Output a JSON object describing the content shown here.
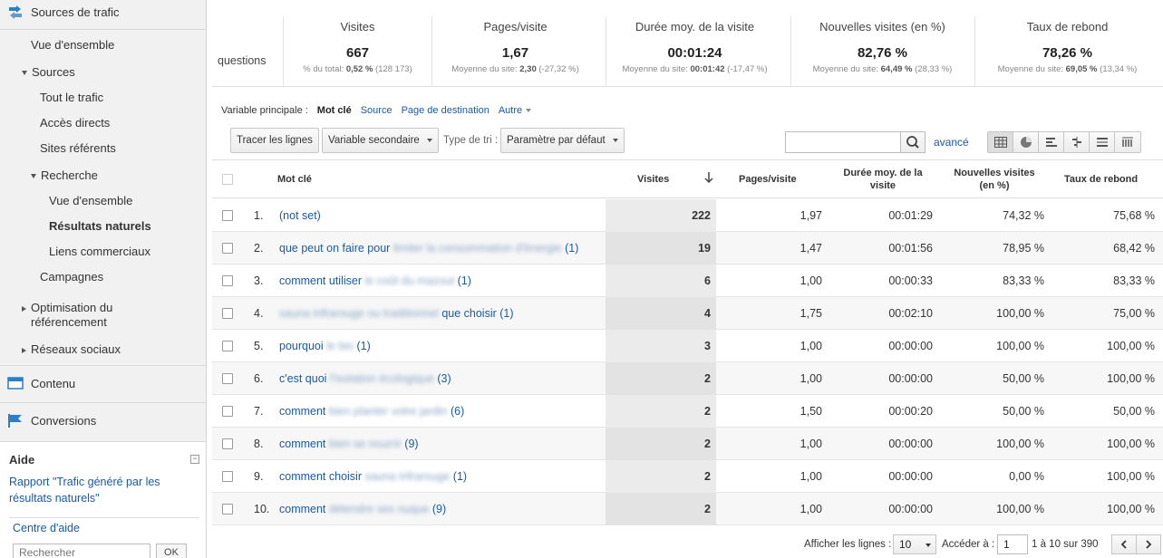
{
  "sidebar": {
    "traffic_sources": "Sources de trafic",
    "overview": "Vue d'ensemble",
    "sources": "Sources",
    "all_traffic": "Tout le trafic",
    "direct": "Accès directs",
    "referrals": "Sites référents",
    "search": "Recherche",
    "search_overview": "Vue d'ensemble",
    "organic": "Résultats naturels",
    "paid": "Liens commerciaux",
    "campaigns": "Campagnes",
    "seo_line1": "Optimisation du",
    "seo_line2": "référencement",
    "social": "Réseaux sociaux",
    "content": "Contenu",
    "conversions": "Conversions"
  },
  "help": {
    "title": "Aide",
    "report_link_line1": "Rapport \"Trafic généré par les",
    "report_link_line2": "résultats naturels\"",
    "help_center": "Centre d'aide",
    "search_placeholder": "Rechercher",
    "ok": "OK"
  },
  "scorecard": {
    "label": "questions",
    "metrics": [
      {
        "name": "Visites",
        "value": "667",
        "sub_prefix": "% du total: ",
        "sub_bold": "0,52 %",
        "sub_suffix": " (128 173)"
      },
      {
        "name": "Pages/visite",
        "value": "1,67",
        "sub_prefix": "Moyenne du site: ",
        "sub_bold": "2,30",
        "sub_suffix": " (-27,32 %)"
      },
      {
        "name": "Durée moy. de la visite",
        "value": "00:01:24",
        "sub_prefix": "Moyenne du site: ",
        "sub_bold": "00:01:42",
        "sub_suffix": " (-17,47 %)"
      },
      {
        "name": "Nouvelles visites (en %)",
        "value": "82,76 %",
        "sub_prefix": "Moyenne du site: ",
        "sub_bold": "64,49 %",
        "sub_suffix": " (28,33 %)"
      },
      {
        "name": "Taux de rebond",
        "value": "78,26 %",
        "sub_prefix": "Moyenne du site: ",
        "sub_bold": "69,05 %",
        "sub_suffix": " (13,34 %)"
      }
    ]
  },
  "dimension_bar": {
    "label": "Variable principale :",
    "selected": "Mot clé",
    "source": "Source",
    "landing": "Page de destination",
    "other": "Autre"
  },
  "toolbar": {
    "plot_rows": "Tracer les lignes",
    "secondary": "Variable secondaire",
    "sort_type_label": "Type de tri :",
    "sort_default": "Paramètre par défaut",
    "advanced": "avancé"
  },
  "table": {
    "headers": {
      "keyword": "Mot clé",
      "visits": "Visites",
      "pages": "Pages/visite",
      "duration_line1": "Durée moy. de la",
      "duration_line2": "visite",
      "new_line1": "Nouvelles visites",
      "new_line2": "(en %)",
      "bounce": "Taux de rebond"
    },
    "rows": [
      {
        "n": "1.",
        "kw": "(not set)",
        "blur": "",
        "tail": "",
        "visits": "222",
        "pages": "1,97",
        "dur": "00:01:29",
        "newv": "74,32 %",
        "bounce": "75,68 %"
      },
      {
        "n": "2.",
        "kw": "que peut on faire pour",
        "blur": "limiter la consommation d'énergie",
        "tail": "(1)",
        "visits": "19",
        "pages": "1,47",
        "dur": "00:01:56",
        "newv": "78,95 %",
        "bounce": "68,42 %"
      },
      {
        "n": "3.",
        "kw": "comment utiliser",
        "blur": "le coût du mazout",
        "tail": "(1)",
        "visits": "6",
        "pages": "1,00",
        "dur": "00:00:33",
        "newv": "83,33 %",
        "bounce": "83,33 %"
      },
      {
        "n": "4.",
        "kw": "",
        "blur": "sauna infrarouge ou traditionnel",
        "tail": "que choisir (1)",
        "visits": "4",
        "pages": "1,75",
        "dur": "00:02:10",
        "newv": "100,00 %",
        "bounce": "75,00 %"
      },
      {
        "n": "5.",
        "kw": "pourquoi",
        "blur": "le bio",
        "tail": "(1)",
        "visits": "3",
        "pages": "1,00",
        "dur": "00:00:00",
        "newv": "100,00 %",
        "bounce": "100,00 %"
      },
      {
        "n": "6.",
        "kw": "c'est quoi",
        "blur": "l'isolation écologique",
        "tail": "(3)",
        "visits": "2",
        "pages": "1,00",
        "dur": "00:00:00",
        "newv": "50,00 %",
        "bounce": "100,00 %"
      },
      {
        "n": "7.",
        "kw": "comment",
        "blur": "bien planter votre jardin",
        "tail": "(6)",
        "visits": "2",
        "pages": "1,50",
        "dur": "00:00:20",
        "newv": "50,00 %",
        "bounce": "50,00 %"
      },
      {
        "n": "8.",
        "kw": "comment",
        "blur": "bien se nourrir",
        "tail": "(9)",
        "visits": "2",
        "pages": "1,00",
        "dur": "00:00:00",
        "newv": "100,00 %",
        "bounce": "100,00 %"
      },
      {
        "n": "9.",
        "kw": "comment choisir",
        "blur": "sauna infrarouge",
        "tail": "(1)",
        "visits": "2",
        "pages": "1,00",
        "dur": "00:00:00",
        "newv": "0,00 %",
        "bounce": "100,00 %"
      },
      {
        "n": "10.",
        "kw": "comment",
        "blur": "détendre ses nuque",
        "tail": "(9)",
        "visits": "2",
        "pages": "1,00",
        "dur": "00:00:00",
        "newv": "100,00 %",
        "bounce": "100,00 %"
      }
    ]
  },
  "footer": {
    "show_rows": "Afficher les lignes :",
    "rows_value": "10",
    "goto": "Accéder à :",
    "goto_value": "1",
    "range": "1 à 10 sur 390"
  },
  "colors": {
    "link": "#1a5aa6",
    "sidebar_bg": "#f1f1f1",
    "sorted_col": "#ebebeb"
  }
}
